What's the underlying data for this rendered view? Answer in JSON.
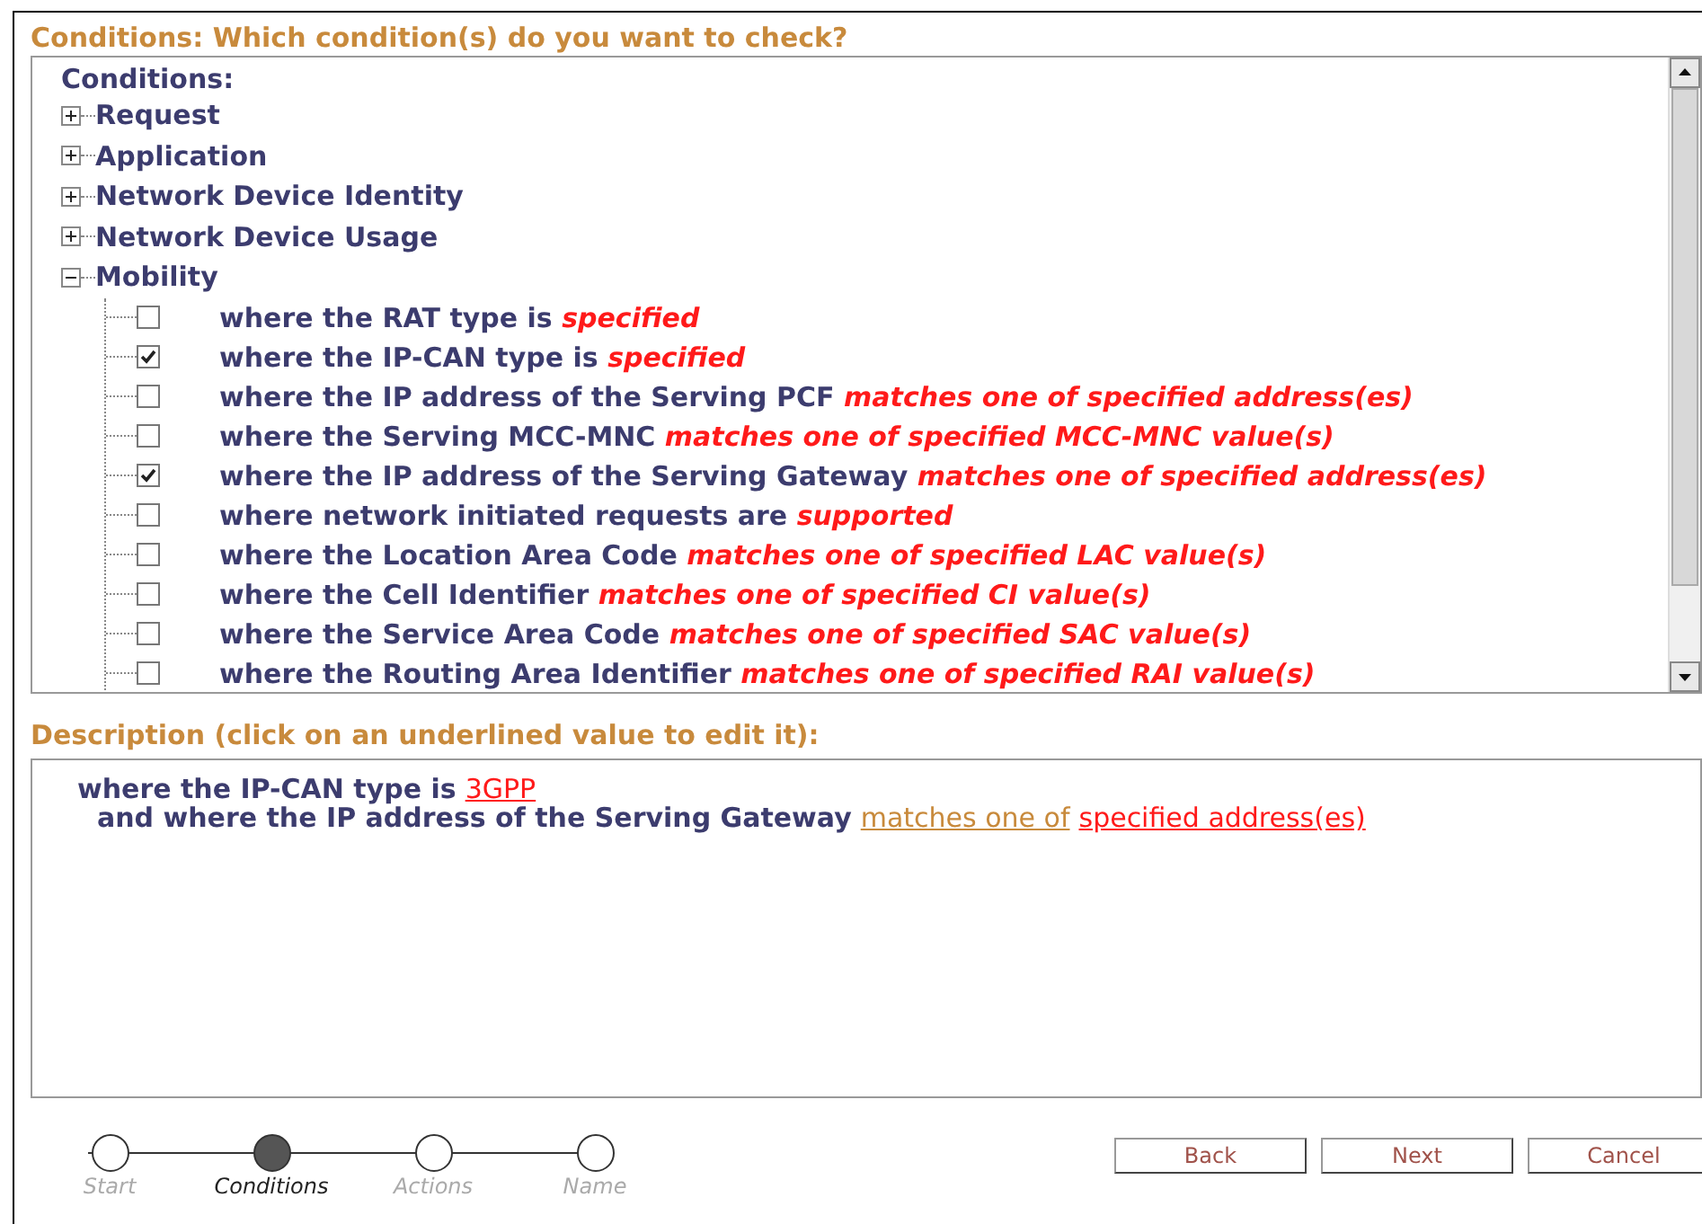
{
  "heading": "Conditions: Which condition(s) do you want to check?",
  "tree": {
    "label": "Conditions:",
    "groups": [
      {
        "label": "Request",
        "expanded": false
      },
      {
        "label": "Application",
        "expanded": false
      },
      {
        "label": "Network Device Identity",
        "expanded": false
      },
      {
        "label": "Network Device Usage",
        "expanded": false
      },
      {
        "label": "Mobility",
        "expanded": true,
        "children": [
          {
            "text": "where the RAT type is",
            "value": "specified",
            "checked": false
          },
          {
            "text": "where the IP-CAN type is",
            "value": "specified",
            "checked": true
          },
          {
            "text": "where the IP address of the Serving PCF",
            "value": "matches one of specified address(es)",
            "checked": false
          },
          {
            "text": "where the Serving MCC-MNC",
            "value": "matches one of specified MCC-MNC value(s)",
            "checked": false
          },
          {
            "text": "where the IP address of the Serving Gateway",
            "value": "matches one of specified address(es)",
            "checked": true
          },
          {
            "text": "where network initiated requests are",
            "value": "supported",
            "checked": false
          },
          {
            "text": "where the Location Area Code",
            "value": "matches one of specified LAC value(s)",
            "checked": false
          },
          {
            "text": "where the Cell Identifier",
            "value": "matches one of specified CI value(s)",
            "checked": false
          },
          {
            "text": "where the Service Area Code",
            "value": "matches one of specified SAC value(s)",
            "checked": false
          },
          {
            "text": "where the Routing Area Identifier",
            "value": "matches one of specified RAI value(s)",
            "checked": false
          }
        ]
      }
    ]
  },
  "description": {
    "heading": "Description (click on an underlined value to edit it):",
    "lines": [
      [
        {
          "kind": "text",
          "text": "where the IP-CAN type is"
        },
        {
          "kind": "value",
          "text": "3GPP"
        }
      ],
      [
        {
          "kind": "text",
          "text": "and where the IP address of the Serving Gateway"
        },
        {
          "kind": "operator",
          "text": "matches one of"
        },
        {
          "kind": "value",
          "text": "specified address(es)"
        }
      ]
    ]
  },
  "steps": [
    {
      "label": "Start",
      "selected": false
    },
    {
      "label": "Conditions",
      "selected": true
    },
    {
      "label": "Actions",
      "selected": false
    },
    {
      "label": "Name",
      "selected": false
    }
  ],
  "buttons": [
    "Back",
    "Next",
    "Cancel"
  ]
}
